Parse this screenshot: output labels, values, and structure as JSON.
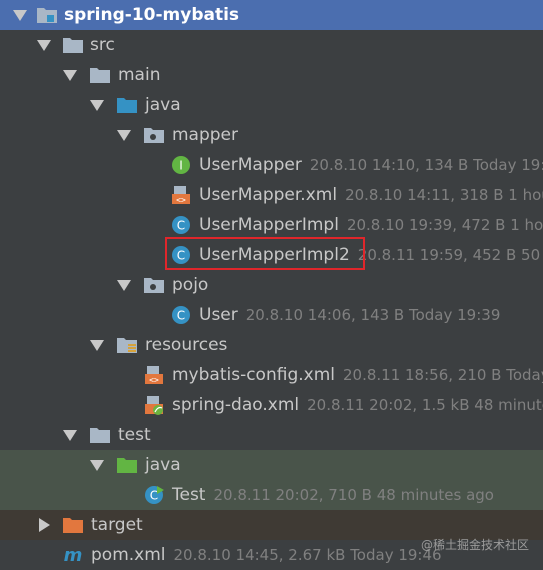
{
  "tree": {
    "project": {
      "label": "spring-10-mybatis"
    },
    "src": {
      "label": "src"
    },
    "main": {
      "label": "main"
    },
    "java_main": {
      "label": "java"
    },
    "mapper": {
      "label": "mapper"
    },
    "user_mapper": {
      "label": "UserMapper",
      "meta": "20.8.10 14:10, 134 B Today 19:"
    },
    "user_mapper_xml": {
      "label": "UserMapper.xml",
      "meta": "20.8.10 14:11, 318 B 1 hou"
    },
    "user_mapper_impl": {
      "label": "UserMapperImpl",
      "meta": "20.8.10 19:39, 472 B 1 ho"
    },
    "user_mapper_impl2": {
      "label": "UserMapperImpl2",
      "meta": "20.8.11 19:59, 452 B 50"
    },
    "pojo": {
      "label": "pojo"
    },
    "user": {
      "label": "User",
      "meta": "20.8.10 14:06, 143 B Today 19:39"
    },
    "resources": {
      "label": "resources"
    },
    "mybatis_config": {
      "label": "mybatis-config.xml",
      "meta": "20.8.11 18:56, 210 B Today"
    },
    "spring_dao": {
      "label": "spring-dao.xml",
      "meta": "20.8.11 20:02, 1.5 kB 48 minute"
    },
    "test": {
      "label": "test"
    },
    "java_test": {
      "label": "java"
    },
    "test_class": {
      "label": "Test",
      "meta": "20.8.11 20:02, 710 B 48 minutes ago"
    },
    "target": {
      "label": "target"
    },
    "pom": {
      "label": "pom.xml",
      "meta": "20.8.10 14:45, 2.67 kB Today 19:46"
    }
  },
  "watermark": "@稀土掘金技术社区",
  "colors": {
    "background": "#3c3f41",
    "selection": "#4b6eaf",
    "test_row": "#49544a",
    "highlight_border": "#e0262b"
  }
}
